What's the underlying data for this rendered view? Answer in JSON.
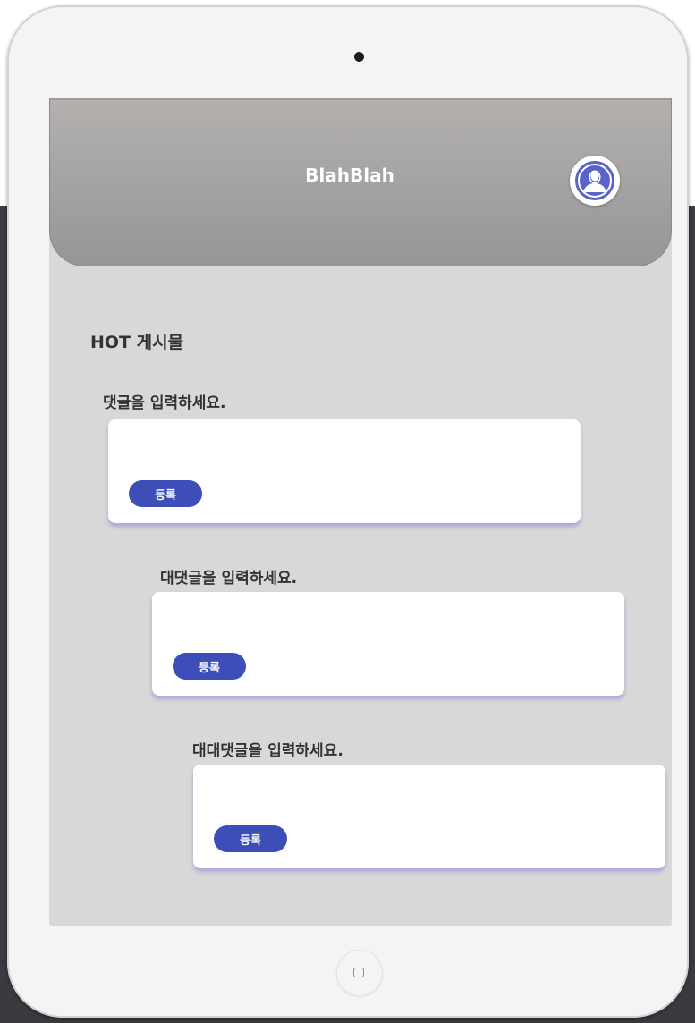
{
  "header": {
    "title": "BlahBlah",
    "avatar_icon": "user-avatar-icon"
  },
  "section": {
    "title": "HOT 게시물"
  },
  "comments": [
    {
      "label": "댓글을 입력하세요.",
      "input_value": "",
      "submit_label": "등록"
    },
    {
      "label": "대댓글을 입력하세요.",
      "input_value": "",
      "submit_label": "등록"
    },
    {
      "label": "대대댓글을 입력하세요.",
      "input_value": "",
      "submit_label": "등록"
    }
  ],
  "colors": {
    "accent": "#3e4eb8",
    "avatar": "#5a63c8",
    "screen_background": "#d8d8d8",
    "header_background": "#a3a2a2"
  }
}
